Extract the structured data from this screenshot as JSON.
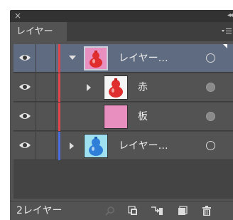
{
  "titlebar": {
    "close_glyph": "×",
    "collapse_glyph": "◂◂"
  },
  "tab": {
    "label": "レイヤー"
  },
  "layers": [
    {
      "name": "レイヤー…",
      "selected": true,
      "expanded": true,
      "color": "#e0454a",
      "thumb": "red-gourd-on-pink",
      "target": "hollow"
    },
    {
      "name": "赤",
      "selected": false,
      "expanded": false,
      "color": "#e0454a",
      "thumb": "red-gourd",
      "target": "filled"
    },
    {
      "name": "板",
      "selected": false,
      "expanded": null,
      "color": "#e0454a",
      "thumb": "pink-board",
      "target": "filled"
    },
    {
      "name": "レイヤー…",
      "selected": false,
      "expanded": false,
      "color": "#4a6ee0",
      "thumb": "blue-gourd-on-cyan",
      "target": "hollow"
    }
  ],
  "footer": {
    "layer_count": "2レイヤー",
    "icons": [
      "locate-object-icon",
      "make-clipping-mask-icon",
      "create-sublayer-icon",
      "new-layer-icon",
      "delete-icon"
    ]
  },
  "colors": {
    "panel_bg": "#535353",
    "selected_row": "#5f6b80",
    "red_layer": "#e0454a",
    "blue_layer": "#4a6ee0"
  }
}
